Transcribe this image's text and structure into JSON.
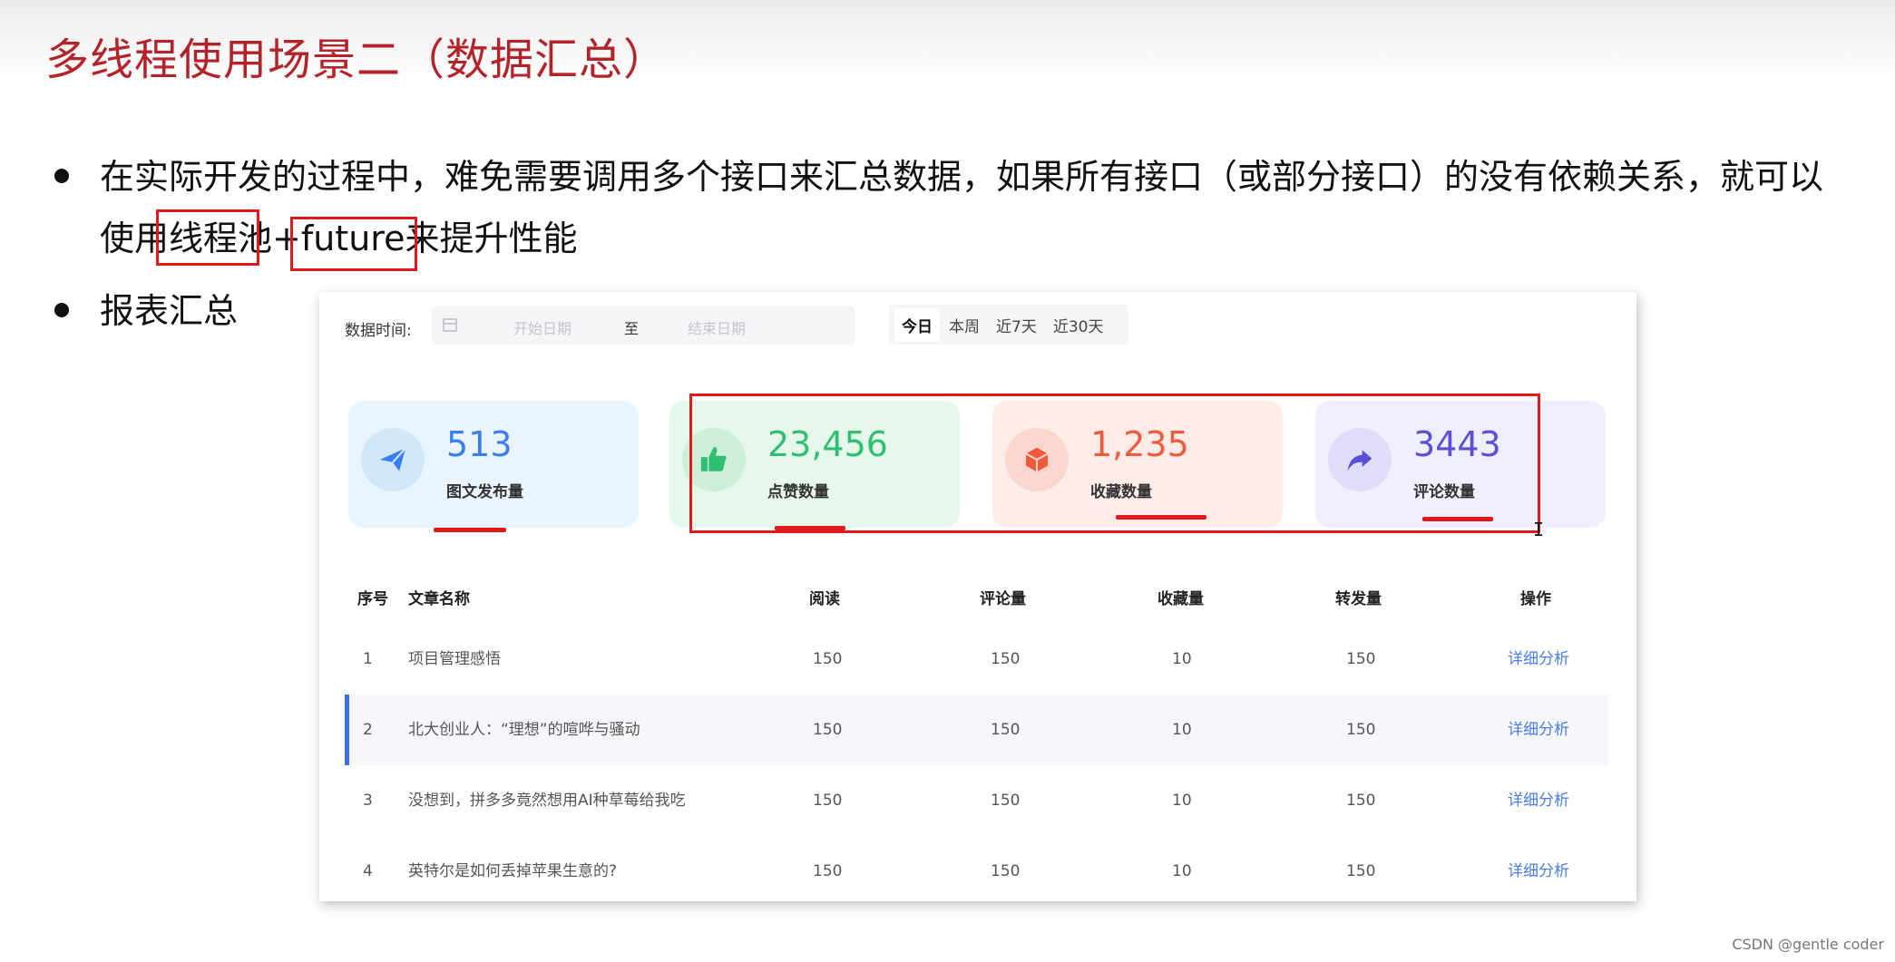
{
  "slide": {
    "title": "多线程使用场景二（数据汇总）",
    "bullets": [
      {
        "line1": "在实际开发的过程中，难免需要调用多个接口来汇总数据，如果所有接口（或部分接口）的没有依赖关系，就可以",
        "line2": "使用线程池+future来提升性能"
      },
      {
        "line1": "报表汇总"
      }
    ],
    "highlight_color": "#e01a1a",
    "title_color": "#b5232a"
  },
  "dashboard": {
    "filter": {
      "label": "数据时间:",
      "start_placeholder": "开始日期",
      "separator": "至",
      "end_placeholder": "结束日期",
      "calendar_icon": "calendar-icon"
    },
    "range_tabs": [
      {
        "label": "今日",
        "active": true
      },
      {
        "label": "本周",
        "active": false
      },
      {
        "label": "近7天",
        "active": false
      },
      {
        "label": "近30天",
        "active": false
      }
    ],
    "stats": [
      {
        "value": "513",
        "label": "图文发布量",
        "icon": "paper-plane-icon",
        "color": "#3b7ef0",
        "bg": "#eaf4ff"
      },
      {
        "value": "23,456",
        "label": "点赞数量",
        "icon": "thumbs-up-icon",
        "color": "#2fbf71",
        "bg": "#e6f7ec"
      },
      {
        "value": "1,235",
        "label": "收藏数量",
        "icon": "box-icon",
        "color": "#f05a3a",
        "bg": "#fdece8"
      },
      {
        "value": "3443",
        "label": "评论数量",
        "icon": "share-arrow-icon",
        "color": "#5a4fd6",
        "bg": "#f0efff"
      }
    ],
    "table": {
      "columns": [
        "序号",
        "文章名称",
        "阅读",
        "评论量",
        "收藏量",
        "转发量",
        "操作"
      ],
      "rows": [
        {
          "index": "1",
          "title": "项目管理感悟",
          "reads": "150",
          "comments": "150",
          "favorites": "10",
          "shares": "150",
          "action": "详细分析"
        },
        {
          "index": "2",
          "title": "北大创业人：“理想”的喧哗与骚动",
          "reads": "150",
          "comments": "150",
          "favorites": "10",
          "shares": "150",
          "action": "详细分析"
        },
        {
          "index": "3",
          "title": "没想到，拼多多竟然想用AI种草莓给我吃",
          "reads": "150",
          "comments": "150",
          "favorites": "10",
          "shares": "150",
          "action": "详细分析"
        },
        {
          "index": "4",
          "title": "英特尔是如何丢掉苹果生意的?",
          "reads": "150",
          "comments": "150",
          "favorites": "10",
          "shares": "150",
          "action": "详细分析"
        }
      ]
    }
  },
  "watermark": "CSDN @gentle coder"
}
